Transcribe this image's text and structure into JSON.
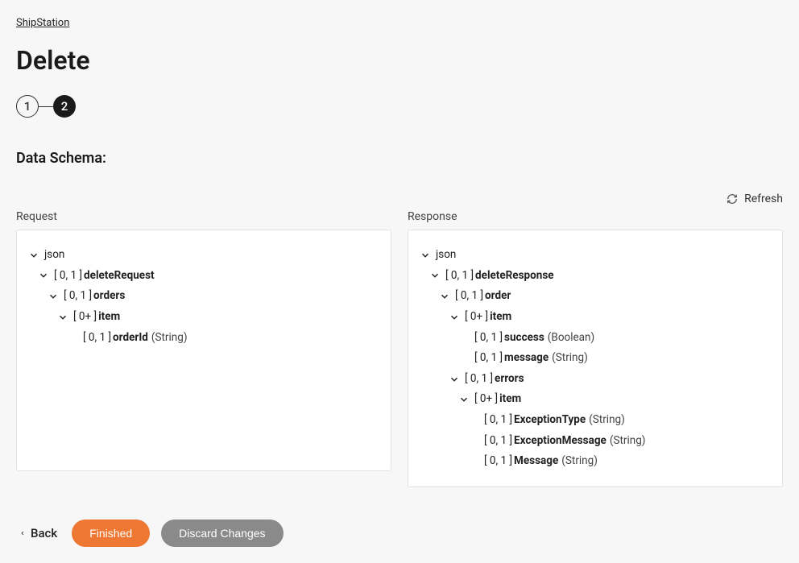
{
  "breadcrumb": "ShipStation",
  "page_title": "Delete",
  "stepper": {
    "step1": "1",
    "step2": "2"
  },
  "section_title": "Data Schema:",
  "refresh_label": "Refresh",
  "request_label": "Request",
  "response_label": "Response",
  "request_tree": {
    "root": "json",
    "n1_card": "[ 0, 1 ]",
    "n1_name": "deleteRequest",
    "n2_card": "[ 0, 1 ]",
    "n2_name": "orders",
    "n3_card": "[ 0+ ]",
    "n3_name": "item",
    "n4_card": "[ 0, 1 ]",
    "n4_name": "orderId",
    "n4_type": "(String)"
  },
  "response_tree": {
    "root": "json",
    "n1_card": "[ 0, 1 ]",
    "n1_name": "deleteResponse",
    "n2_card": "[ 0, 1 ]",
    "n2_name": "order",
    "n3_card": "[ 0+ ]",
    "n3_name": "item",
    "n4_card": "[ 0, 1 ]",
    "n4_name": "success",
    "n4_type": "(Boolean)",
    "n5_card": "[ 0, 1 ]",
    "n5_name": "message",
    "n5_type": "(String)",
    "n6_card": "[ 0, 1 ]",
    "n6_name": "errors",
    "n7_card": "[ 0+ ]",
    "n7_name": "item",
    "n8_card": "[ 0, 1 ]",
    "n8_name": "ExceptionType",
    "n8_type": "(String)",
    "n9_card": "[ 0, 1 ]",
    "n9_name": "ExceptionMessage",
    "n9_type": "(String)",
    "n10_card": "[ 0, 1 ]",
    "n10_name": "Message",
    "n10_type": "(String)"
  },
  "footer": {
    "back": "Back",
    "finished": "Finished",
    "discard": "Discard Changes"
  }
}
